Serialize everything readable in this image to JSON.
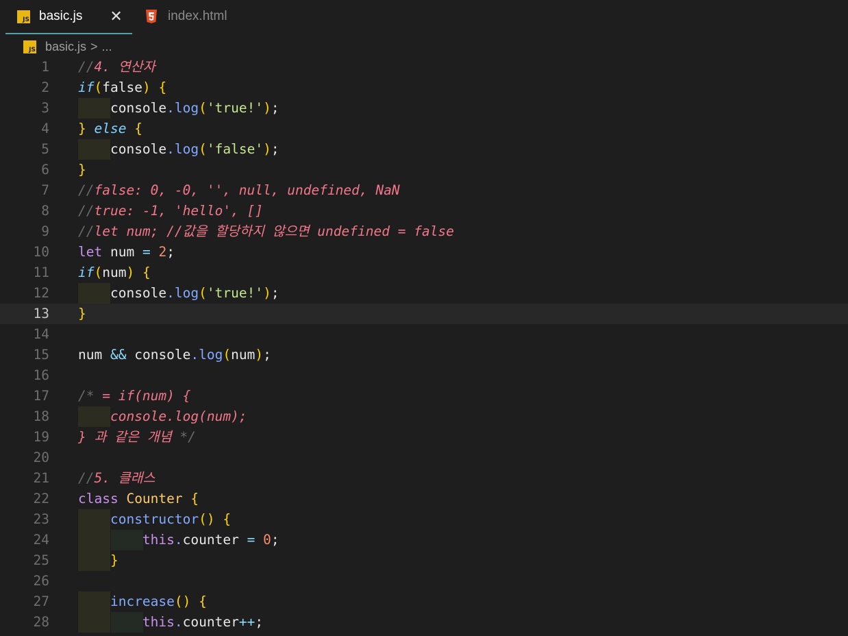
{
  "tabs": [
    {
      "label": "basic.js",
      "icon": "js-file-icon",
      "active": true
    },
    {
      "label": "index.html",
      "icon": "html5-file-icon",
      "active": false
    }
  ],
  "breadcrumb": {
    "file": "basic.js",
    "separator": ">",
    "more": "..."
  },
  "editor": {
    "current_line": 13,
    "lines": [
      {
        "n": "1",
        "t": "//4. 연산자"
      },
      {
        "n": "2",
        "t": "if(false) {"
      },
      {
        "n": "3",
        "t": "    console.log('true!');"
      },
      {
        "n": "4",
        "t": "} else {"
      },
      {
        "n": "5",
        "t": "    console.log('false');"
      },
      {
        "n": "6",
        "t": "}"
      },
      {
        "n": "7",
        "t": "//false: 0, -0, '', null, undefined, NaN"
      },
      {
        "n": "8",
        "t": "//true: -1, 'hello', []"
      },
      {
        "n": "9",
        "t": "//let num; //값을 할당하지 않으면 undefined = false"
      },
      {
        "n": "10",
        "t": "let num = 2;"
      },
      {
        "n": "11",
        "t": "if(num) {"
      },
      {
        "n": "12",
        "t": "    console.log('true!');"
      },
      {
        "n": "13",
        "t": "}"
      },
      {
        "n": "14",
        "t": ""
      },
      {
        "n": "15",
        "t": "num && console.log(num);"
      },
      {
        "n": "16",
        "t": ""
      },
      {
        "n": "17",
        "t": "/* = if(num) {"
      },
      {
        "n": "18",
        "t": "    console.log(num);"
      },
      {
        "n": "19",
        "t": "} 과 같은 개념 */"
      },
      {
        "n": "20",
        "t": ""
      },
      {
        "n": "21",
        "t": "//5. 클래스"
      },
      {
        "n": "22",
        "t": "class Counter {"
      },
      {
        "n": "23",
        "t": "    constructor() {"
      },
      {
        "n": "24",
        "t": "        this.counter = 0;"
      },
      {
        "n": "25",
        "t": "    }"
      },
      {
        "n": "26",
        "t": ""
      },
      {
        "n": "27",
        "t": "    increase() {"
      },
      {
        "n": "28",
        "t": "        this.counter++;"
      }
    ]
  }
}
